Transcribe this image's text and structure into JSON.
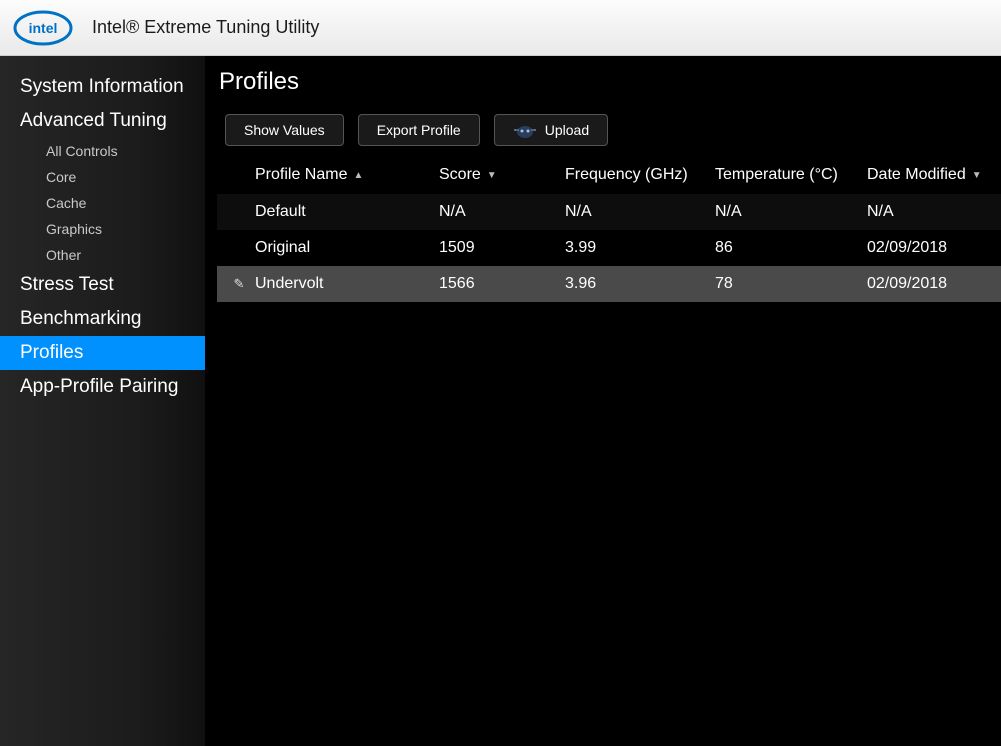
{
  "header": {
    "app_title": "Intel® Extreme Tuning Utility",
    "logo_text": "intel"
  },
  "sidebar": {
    "items": [
      {
        "label": "System Information",
        "selected": false,
        "children": []
      },
      {
        "label": "Advanced Tuning",
        "selected": false,
        "children": [
          {
            "label": "All Controls"
          },
          {
            "label": "Core"
          },
          {
            "label": "Cache"
          },
          {
            "label": "Graphics"
          },
          {
            "label": "Other"
          }
        ]
      },
      {
        "label": "Stress Test",
        "selected": false,
        "children": []
      },
      {
        "label": "Benchmarking",
        "selected": false,
        "children": []
      },
      {
        "label": "Profiles",
        "selected": true,
        "children": []
      },
      {
        "label": "App-Profile Pairing",
        "selected": false,
        "children": []
      }
    ]
  },
  "main": {
    "title": "Profiles",
    "toolbar": {
      "show_values": "Show Values",
      "export_profile": "Export Profile",
      "upload": "Upload"
    },
    "table": {
      "columns": {
        "name": "Profile Name",
        "score": "Score",
        "freq": "Frequency (GHz)",
        "temp": "Temperature (°C)",
        "date": "Date Modified"
      },
      "sort": {
        "name": "asc",
        "score": "desc",
        "date": "desc"
      },
      "rows": [
        {
          "name": "Default",
          "score": "N/A",
          "freq": "N/A",
          "temp": "N/A",
          "date": "N/A",
          "selected": false,
          "editing": false
        },
        {
          "name": "Original",
          "score": "1509",
          "freq": "3.99",
          "temp": "86",
          "date": "02/09/2018",
          "selected": false,
          "editing": false
        },
        {
          "name": "Undervolt",
          "score": "1566",
          "freq": "3.96",
          "temp": "78",
          "date": "02/09/2018",
          "selected": true,
          "editing": true
        }
      ]
    }
  }
}
